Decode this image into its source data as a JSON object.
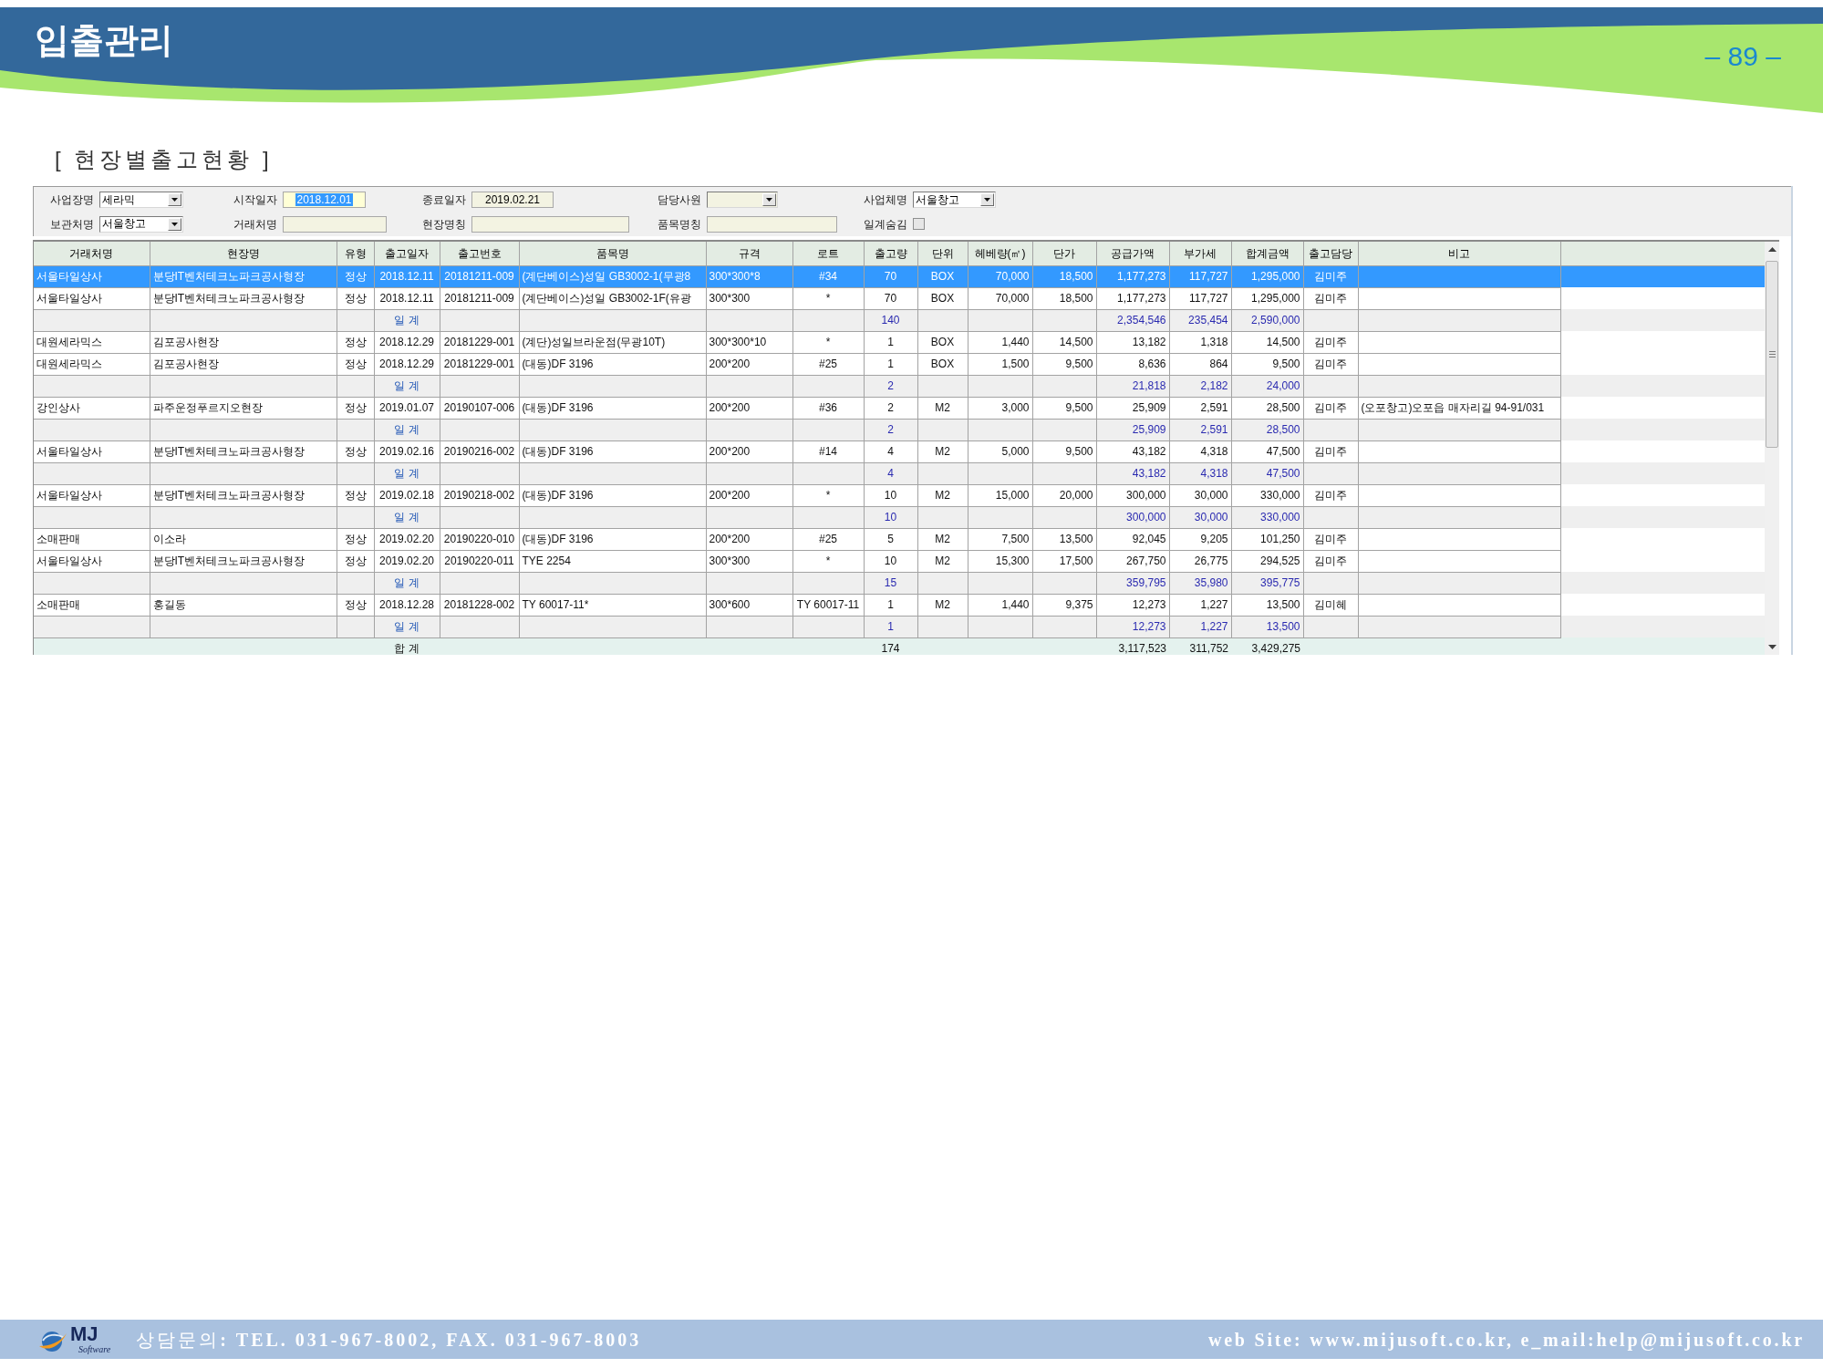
{
  "header": {
    "title": "입출관리",
    "page_number": "– 89 –"
  },
  "section_title": "[ 현장별출고현황 ]",
  "filters": [
    {
      "kind": "combo",
      "label": "사업장명",
      "value": "세라믹",
      "focused": false
    },
    {
      "kind": "date",
      "label": "시작일자",
      "value": "2018.12.01",
      "focused": true
    },
    {
      "kind": "date",
      "label": "종료일자",
      "value": "2019.02.21",
      "focused": false
    },
    {
      "kind": "combo",
      "label": "담당사원",
      "focused": false
    },
    {
      "kind": "combo",
      "label": "사업체명",
      "value": "서울창고",
      "focused": false
    },
    {
      "kind": "combo",
      "label": "보관처명",
      "value": "서울창고",
      "focused": false
    },
    {
      "kind": "text",
      "label": "거래처명",
      "focused": false
    },
    {
      "kind": "text",
      "label": "현장명칭",
      "focused": false
    },
    {
      "kind": "text",
      "label": "품목명칭",
      "focused": false
    },
    {
      "kind": "checkbox",
      "label": "일계숨김",
      "checked": false
    }
  ],
  "table": {
    "columns": [
      "거래처명",
      "현장명",
      "유형",
      "출고일자",
      "출고번호",
      "품목명",
      "규격",
      "로트",
      "출고량",
      "단위",
      "헤베량(㎡)",
      "단가",
      "공급가액",
      "부가세",
      "합계금액",
      "출고담당",
      "비고"
    ],
    "rows": [
      {
        "kind": "item",
        "selected": true,
        "client": "서울타일상사",
        "site": "분당IT벤처테크노파크공사형장",
        "type": "정상",
        "date": "2018.12.11",
        "number": "20181211-009",
        "item": "(계단베이스)성일 GB3002-1(무광8",
        "spec": "300*300*8",
        "lot": "#34",
        "qty": "70",
        "unit": "BOX",
        "area": "70,000",
        "price": "18,500",
        "supply": "1,177,273",
        "vat": "117,727",
        "amount": "1,295,000",
        "manager": "김미주"
      },
      {
        "kind": "item",
        "selected": false,
        "client": "서울타일상사",
        "site": "분당IT벤처테크노파크공사형장",
        "type": "정상",
        "date": "2018.12.11",
        "number": "20181211-009",
        "item": "(계단베이스)성일 GB3002-1F(유광",
        "spec": "300*300",
        "lot": "*",
        "qty": "70",
        "unit": "BOX",
        "area": "70,000",
        "price": "18,500",
        "supply": "1,177,273",
        "vat": "117,727",
        "amount": "1,295,000",
        "manager": "김미주"
      },
      {
        "kind": "subtotal",
        "selected": false,
        "label": "일 계",
        "qty": "140",
        "supply": "2,354,546",
        "vat": "235,454",
        "amount": "2,590,000"
      },
      {
        "kind": "item",
        "selected": false,
        "client": "대원세라믹스",
        "site": "김포공사현장",
        "type": "정상",
        "date": "2018.12.29",
        "number": "20181229-001",
        "item": "(계단)성일브라운점(무광10T)",
        "spec": "300*300*10",
        "lot": "*",
        "qty": "1",
        "unit": "BOX",
        "area": "1,440",
        "price": "14,500",
        "supply": "13,182",
        "vat": "1,318",
        "amount": "14,500",
        "manager": "김미주"
      },
      {
        "kind": "item",
        "selected": false,
        "client": "대원세라믹스",
        "site": "김포공사현장",
        "type": "정상",
        "date": "2018.12.29",
        "number": "20181229-001",
        "item": "(대동)DF 3196",
        "spec": "200*200",
        "lot": "#25",
        "qty": "1",
        "unit": "BOX",
        "area": "1,500",
        "price": "9,500",
        "supply": "8,636",
        "vat": "864",
        "amount": "9,500",
        "manager": "김미주"
      },
      {
        "kind": "subtotal",
        "selected": false,
        "label": "일 계",
        "qty": "2",
        "supply": "21,818",
        "vat": "2,182",
        "amount": "24,000"
      },
      {
        "kind": "item",
        "selected": false,
        "client": "강인상사",
        "site": "파주운정푸르지오현장",
        "type": "정상",
        "date": "2019.01.07",
        "number": "20190107-006",
        "item": "(대동)DF 3196",
        "spec": "200*200",
        "lot": "#36",
        "qty": "2",
        "unit": "M2",
        "area": "3,000",
        "price": "9,500",
        "supply": "25,909",
        "vat": "2,591",
        "amount": "28,500",
        "manager": "김미주",
        "note": "(오포창고)오포읍 매자리길 94-91/031"
      },
      {
        "kind": "subtotal",
        "selected": false,
        "label": "일 계",
        "qty": "2",
        "supply": "25,909",
        "vat": "2,591",
        "amount": "28,500"
      },
      {
        "kind": "item",
        "selected": false,
        "client": "서울타일상사",
        "site": "분당IT벤처테크노파크공사형장",
        "type": "정상",
        "date": "2019.02.16",
        "number": "20190216-002",
        "item": "(대동)DF 3196",
        "spec": "200*200",
        "lot": "#14",
        "qty": "4",
        "unit": "M2",
        "area": "5,000",
        "price": "9,500",
        "supply": "43,182",
        "vat": "4,318",
        "amount": "47,500",
        "manager": "김미주"
      },
      {
        "kind": "subtotal",
        "selected": false,
        "label": "일 계",
        "qty": "4",
        "supply": "43,182",
        "vat": "4,318",
        "amount": "47,500"
      },
      {
        "kind": "item",
        "selected": false,
        "client": "서울타일상사",
        "site": "분당IT벤처테크노파크공사형장",
        "type": "정상",
        "date": "2019.02.18",
        "number": "20190218-002",
        "item": "(대동)DF 3196",
        "spec": "200*200",
        "lot": "*",
        "qty": "10",
        "unit": "M2",
        "area": "15,000",
        "price": "20,000",
        "supply": "300,000",
        "vat": "30,000",
        "amount": "330,000",
        "manager": "김미주"
      },
      {
        "kind": "subtotal",
        "selected": false,
        "label": "일 계",
        "qty": "10",
        "supply": "300,000",
        "vat": "30,000",
        "amount": "330,000"
      },
      {
        "kind": "item",
        "selected": false,
        "client": "소매판매",
        "site": "이소라",
        "type": "정상",
        "date": "2019.02.20",
        "number": "20190220-010",
        "item": "(대동)DF 3196",
        "spec": "200*200",
        "lot": "#25",
        "qty": "5",
        "unit": "M2",
        "area": "7,500",
        "price": "13,500",
        "supply": "92,045",
        "vat": "9,205",
        "amount": "101,250",
        "manager": "김미주"
      },
      {
        "kind": "item",
        "selected": false,
        "client": "서울타일상사",
        "site": "분당IT벤처테크노파크공사형장",
        "type": "정상",
        "date": "2019.02.20",
        "number": "20190220-011",
        "item": "TYE 2254",
        "spec": "300*300",
        "lot": "*",
        "qty": "10",
        "unit": "M2",
        "area": "15,300",
        "price": "17,500",
        "supply": "267,750",
        "vat": "26,775",
        "amount": "294,525",
        "manager": "김미주"
      },
      {
        "kind": "subtotal",
        "selected": false,
        "label": "일 계",
        "qty": "15",
        "supply": "359,795",
        "vat": "35,980",
        "amount": "395,775"
      },
      {
        "kind": "item",
        "selected": false,
        "client": "소매판매",
        "site": "홍길동",
        "type": "정상",
        "date": "2018.12.28",
        "number": "20181228-002",
        "item": "TY 60017-11*",
        "spec": "300*600",
        "lot": "TY 60017-11",
        "qty": "1",
        "unit": "M2",
        "area": "1,440",
        "price": "9,375",
        "supply": "12,273",
        "vat": "1,227",
        "amount": "13,500",
        "manager": "김미혜"
      },
      {
        "kind": "subtotal",
        "selected": false,
        "label": "일 계",
        "qty": "1",
        "supply": "12,273",
        "vat": "1,227",
        "amount": "13,500"
      },
      {
        "kind": "total",
        "selected": false,
        "label": "합 계",
        "qty": "174",
        "supply": "3,117,523",
        "vat": "311,752",
        "amount": "3,429,275"
      }
    ]
  },
  "footer": {
    "logo": {
      "name": "MJ",
      "tagline": "Software"
    },
    "contact": "상담문의**: TEL. 031-967-8002, FAX. 031-967-8003**",
    "website": "web Site: www.mijusoft.co.kr, e_mail:help@mijusoft.co.kr"
  }
}
